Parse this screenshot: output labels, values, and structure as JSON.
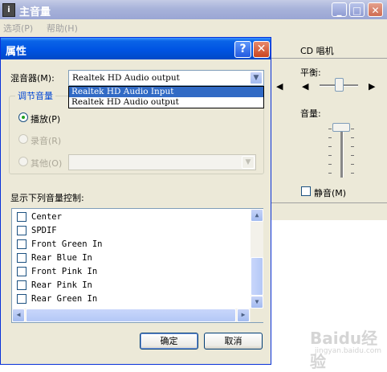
{
  "main_window": {
    "title": "主音量",
    "icon": "volume-app-icon",
    "menu": [
      "选项(P)",
      "帮助(H)"
    ],
    "channel": {
      "name": "CD 唱机",
      "balance_label": "平衡:",
      "volume_label": "音量:",
      "mute_label": "静音(M)",
      "mute_checked": false
    }
  },
  "dialog": {
    "title": "属性",
    "help_label": "?",
    "close_label": "✕",
    "mixer_label": "混音器(M):",
    "mixer_value": "Realtek HD Audio output",
    "mixer_options": [
      "Realtek HD Audio Input",
      "Realtek HD Audio output"
    ],
    "mixer_highlighted": "Realtek HD Audio Input",
    "adjust_group": {
      "title": "调节音量",
      "options": [
        {
          "label": "播放(P)",
          "selected": true,
          "enabled": true
        },
        {
          "label": "录音(R)",
          "selected": false,
          "enabled": false
        },
        {
          "label": "其他(O)",
          "selected": false,
          "enabled": false
        }
      ]
    },
    "controls_label": "显示下列音量控制:",
    "controls": [
      {
        "label": "Center",
        "checked": false
      },
      {
        "label": "SPDIF",
        "checked": false
      },
      {
        "label": "Front Green In",
        "checked": false
      },
      {
        "label": "Rear Blue In",
        "checked": false
      },
      {
        "label": "Front Pink In",
        "checked": false
      },
      {
        "label": "Rear Pink In",
        "checked": false
      },
      {
        "label": "Rear Green In",
        "checked": false
      }
    ],
    "ok_label": "确定",
    "cancel_label": "取消"
  },
  "watermark": {
    "text": "Baidu经验",
    "sub": "jingyan.baidu.com"
  },
  "colors": {
    "accent": "#0054e3",
    "face": "#ece9d8",
    "selection": "#316ac5"
  }
}
